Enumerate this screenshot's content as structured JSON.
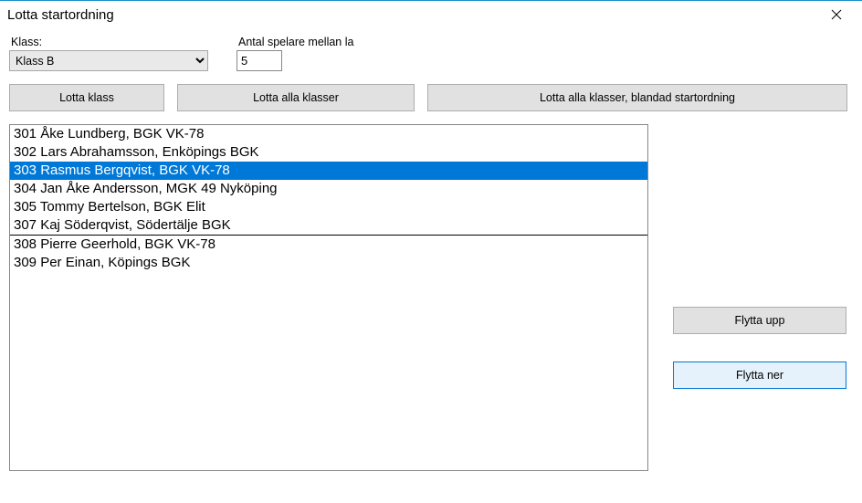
{
  "window": {
    "title": "Lotta startordning"
  },
  "form": {
    "klass_label": "Klass:",
    "klass_value": "Klass B",
    "antal_label": "Antal spelare mellan la",
    "antal_value": "5"
  },
  "buttons": {
    "lotta_klass": "Lotta klass",
    "lotta_alla": "Lotta alla klasser",
    "lotta_blandad": "Lotta alla klasser, blandad startordning",
    "flytta_upp": "Flytta upp",
    "flytta_ner": "Flytta ner"
  },
  "list": {
    "selected_index": 2,
    "divider_after_index": 5,
    "items": [
      "301 Åke Lundberg, BGK VK-78",
      "302 Lars Abrahamsson, Enköpings BGK",
      "303 Rasmus Bergqvist, BGK VK-78",
      "304 Jan Åke Andersson, MGK 49 Nyköping",
      "305 Tommy Bertelson, BGK Elit",
      "307 Kaj Söderqvist, Södertälje BGK",
      "308 Pierre Geerhold, BGK VK-78",
      "309 Per Einan, Köpings BGK"
    ]
  }
}
